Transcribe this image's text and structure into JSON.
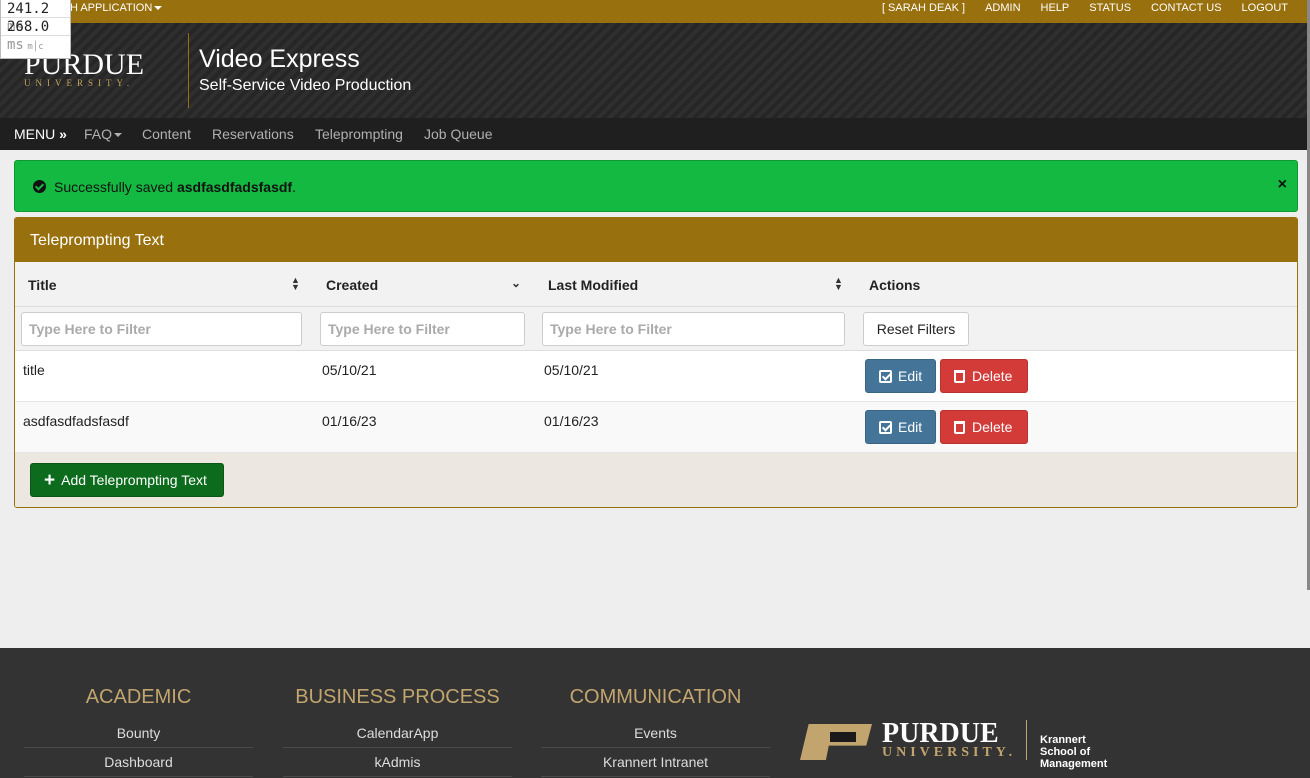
{
  "perf": {
    "row1_value": "241.2",
    "row2_value": "268.0",
    "unit": "ms",
    "mc": "m│c"
  },
  "topbar": {
    "switch_label": "CH APPLICATION",
    "links": [
      "[ SARAH DEAK ]",
      "ADMIN",
      "HELP",
      "STATUS",
      "CONTACT US",
      "LOGOUT"
    ]
  },
  "header": {
    "logo_big": "PURDUE",
    "logo_small": "UNIVERSITY.",
    "title": "Video Express",
    "subtitle": "Self-Service Video Production"
  },
  "nav": {
    "menu": "MENU",
    "menu_glyph": "»",
    "items": [
      "FAQ",
      "Content",
      "Reservations",
      "Teleprompting",
      "Job Queue"
    ]
  },
  "alert": {
    "prefix": "Successfully saved ",
    "item": "asdfasdfadsfasdf",
    "suffix": ".",
    "close": "×"
  },
  "panel": {
    "title": "Teleprompting Text",
    "columns": [
      "Title",
      "Created",
      "Last Modified",
      "Actions"
    ],
    "filter_placeholder": "Type Here to Filter",
    "reset_label": "Reset Filters",
    "rows": [
      {
        "title": "title",
        "created": "05/10/21",
        "modified": "05/10/21"
      },
      {
        "title": "asdfasdfadsfasdf",
        "created": "01/16/23",
        "modified": "01/16/23"
      }
    ],
    "edit_label": "Edit",
    "delete_label": "Delete",
    "add_label": "Add Teleprompting Text"
  },
  "footer": {
    "columns": [
      {
        "heading": "ACADEMIC",
        "links": [
          "Bounty",
          "Dashboard"
        ]
      },
      {
        "heading": "BUSINESS PROCESS",
        "links": [
          "CalendarApp",
          "kAdmis"
        ]
      },
      {
        "heading": "COMMUNICATION",
        "links": [
          "Events",
          "Krannert Intranet"
        ]
      }
    ],
    "logo_big": "PURDUE",
    "logo_small": "UNIVERSITY.",
    "school": "Krannert School of Management"
  },
  "colors": {
    "gold": "#98700d",
    "success": "#13b940",
    "edit": "#447599",
    "delete": "#d33b38",
    "add": "#0c6b1c"
  }
}
